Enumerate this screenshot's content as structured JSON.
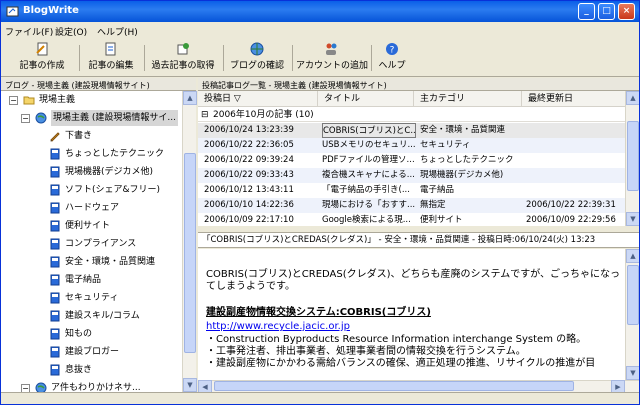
{
  "window": {
    "title": "BlogWrite"
  },
  "menu": [
    "ファイル(F)",
    "設定(O)",
    "ヘルプ(H)"
  ],
  "toolbar": {
    "new_post": "記事の作成",
    "edit_post": "記事の編集",
    "fetch_posts": "過去記事の取得",
    "check_blog": "ブログの確認",
    "add_account": "アカウントの追加",
    "help": "ヘルプ"
  },
  "left_panel": {
    "header": "ブログ - 現場主義 (建設現場情報サイト)",
    "tree": [
      {
        "label": "現場主義",
        "level": 0,
        "icon": "folder-icon"
      },
      {
        "label": "現場主義 (建設現場情報サイ...",
        "level": 1,
        "icon": "blog-globe-icon",
        "selected": true
      },
      {
        "label": "下書き",
        "level": 2,
        "icon": "draft-pencil-icon"
      },
      {
        "label": "ちょっとしたテクニック",
        "level": 2,
        "icon": "category-book-icon"
      },
      {
        "label": "現場機器(デジカメ他)",
        "level": 2,
        "icon": "category-book-icon"
      },
      {
        "label": "ソフト(シェア&フリー)",
        "level": 2,
        "icon": "category-book-icon"
      },
      {
        "label": "ハードウェア",
        "level": 2,
        "icon": "category-book-icon"
      },
      {
        "label": "便利サイト",
        "level": 2,
        "icon": "category-book-icon"
      },
      {
        "label": "コンプライアンス",
        "level": 2,
        "icon": "category-book-icon"
      },
      {
        "label": "安全・環境・品質関連",
        "level": 2,
        "icon": "category-book-icon"
      },
      {
        "label": "電子納品",
        "level": 2,
        "icon": "category-book-icon"
      },
      {
        "label": "セキュリティ",
        "level": 2,
        "icon": "category-book-icon"
      },
      {
        "label": "建設スキル/コラム",
        "level": 2,
        "icon": "category-book-icon"
      },
      {
        "label": "知もの",
        "level": 2,
        "icon": "category-book-icon"
      },
      {
        "label": "建設ブロガー",
        "level": 2,
        "icon": "category-book-icon"
      },
      {
        "label": "息抜き",
        "level": 2,
        "icon": "category-book-icon"
      },
      {
        "label": "ア件もわりかけネサ...",
        "level": 1,
        "icon": "blog-globe-icon"
      }
    ]
  },
  "right_panel": {
    "header": "投稿記事ログ一覧 - 現場主義 (建設現場情報サイト)",
    "columns": [
      "投稿日",
      "タイトル",
      "主カテゴリ",
      "最終更新日"
    ],
    "group_label": "2006年10月の記事 (10)",
    "rows": [
      {
        "date": "2006/10/24 13:23:39",
        "title": "COBRIS(コブリス)とC...",
        "category": "安全・環境・品質関連",
        "updated": ""
      },
      {
        "date": "2006/10/22 22:36:05",
        "title": "USBメモリのセキュリ...",
        "category": "セキュリティ",
        "updated": ""
      },
      {
        "date": "2006/10/22 09:39:24",
        "title": "PDFファイルの管理ソ...",
        "category": "ちょっとしたテクニック",
        "updated": ""
      },
      {
        "date": "2006/10/22 09:33:43",
        "title": "複合機スキャナによる...",
        "category": "現場機器(デジカメ他)",
        "updated": ""
      },
      {
        "date": "2006/10/12 13:43:11",
        "title": "「電子納品の手引き(...",
        "category": "電子納品",
        "updated": ""
      },
      {
        "date": "2006/10/10 14:22:36",
        "title": "現場における「おすす...",
        "category": "無指定",
        "updated": "2006/10/22 22:39:31"
      },
      {
        "date": "2006/10/09 22:17:10",
        "title": "Google検索による現...",
        "category": "便利サイト",
        "updated": "2006/10/09 22:29:56"
      }
    ]
  },
  "info_bar": "「COBRIS(コブリス)とCREDAS(クレダス)」 - 安全・環境・品質関連 - 投稿日時:06/10/24(火) 13:23",
  "content": {
    "para1_line1": "COBRIS(コブリス)とCREDAS(クレダス)、どちらも産廃のシステムですが、ごっちゃになっ",
    "para1_line2": "てしまうようです。",
    "heading": "建設副産物情報交換システム:COBRIS(コブリス)",
    "link": "http://www.recycle.jacic.or.jp",
    "bullet1": "・Construction Byproducts Resource Information interchange System の略。",
    "bullet2": "・工事発注者、排出事業者、処理事業者間の情報交換を行うシステム。",
    "bullet3": "・建設副産物にかかわる需給バランスの確保、適正処理の推進、リサイクルの推進が目"
  }
}
